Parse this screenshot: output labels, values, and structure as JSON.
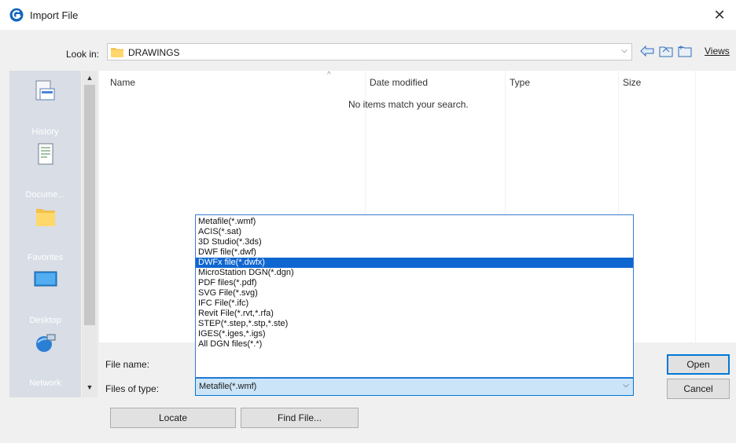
{
  "dialog": {
    "title": "Import File",
    "close_glyph": "✕"
  },
  "lookin": {
    "label": "Look in:",
    "value": "DRAWINGS",
    "views_label": "Views"
  },
  "places": [
    {
      "label": "History",
      "icon": "history-icon"
    },
    {
      "label": "Docume...",
      "icon": "documents-icon"
    },
    {
      "label": "Favorites",
      "icon": "favorites-icon"
    },
    {
      "label": "Desktop",
      "icon": "desktop-icon"
    },
    {
      "label": "Network",
      "icon": "network-icon"
    }
  ],
  "filelist": {
    "columns": [
      "Name",
      "Date modified",
      "Type",
      "Size"
    ],
    "empty_message": "No items match your search."
  },
  "filename": {
    "label": "File name:",
    "value": ""
  },
  "filetype": {
    "label": "Files of type:",
    "selected": "Metafile(*.wmf)",
    "options": [
      "Metafile(*.wmf)",
      "ACIS(*.sat)",
      "3D Studio(*.3ds)",
      "DWF file(*.dwf)",
      "DWFx file(*.dwfx)",
      "MicroStation DGN(*.dgn)",
      "PDF files(*.pdf)",
      "SVG File(*.svg)",
      "IFC File(*.ifc)",
      "Revit File(*.rvt,*.rfa)",
      "STEP(*.step,*.stp,*.ste)",
      "IGES(*.iges,*.igs)",
      "All DGN files(*.*)"
    ],
    "highlighted_index": 4
  },
  "buttons": {
    "open": "Open",
    "cancel": "Cancel",
    "locate": "Locate",
    "find_file": "Find File..."
  },
  "colors": {
    "accent": "#0078d7",
    "selection": "#0f66d0",
    "places_bg": "#d8dde6"
  }
}
